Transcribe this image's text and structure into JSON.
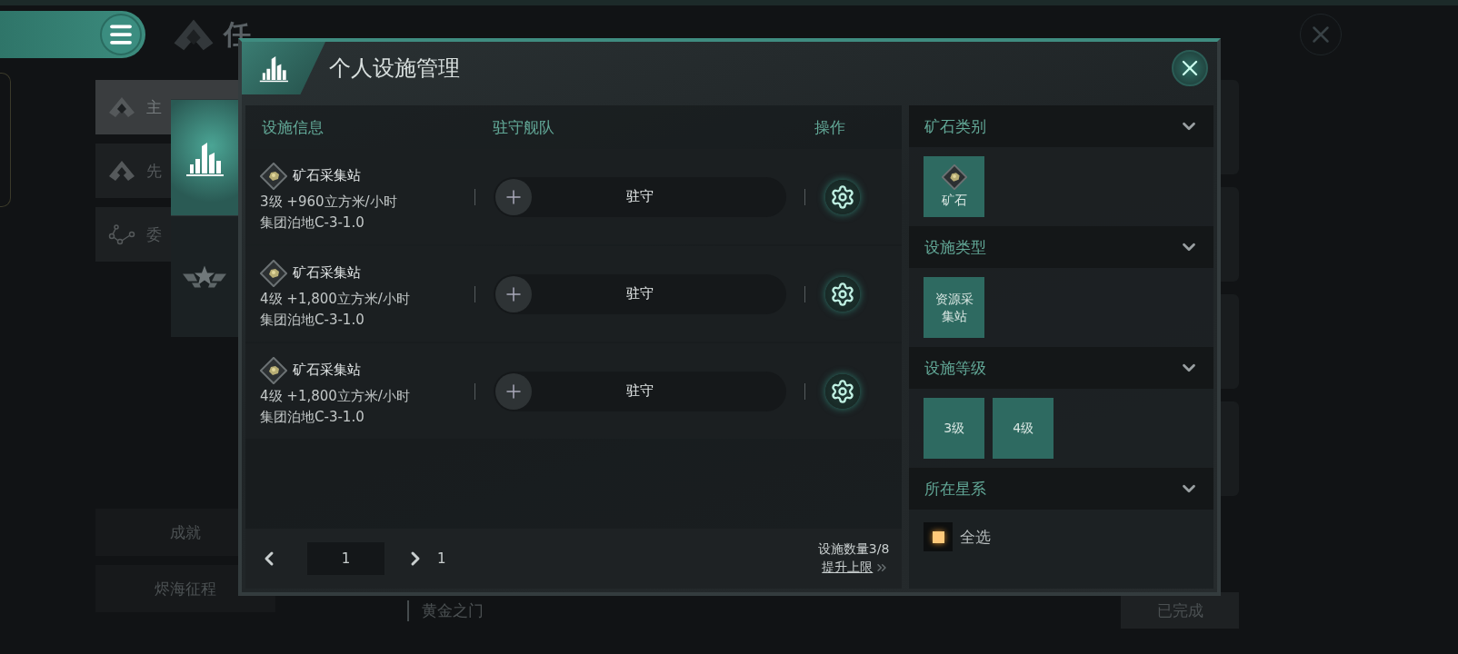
{
  "page": {
    "title": "任"
  },
  "sidebar": {
    "items": [
      {
        "label": "主",
        "kind": "emblem",
        "selected": true
      },
      {
        "label": "先",
        "kind": "emblem",
        "selected": false
      },
      {
        "label": "委",
        "kind": "nodes",
        "selected": false
      }
    ],
    "bottom_buttons": [
      "成就",
      "烬海征程"
    ]
  },
  "background_task": {
    "name": "黄金之门",
    "status": "已完成"
  },
  "dialog": {
    "title": "个人设施管理",
    "side_tabs": [
      {
        "kind": "buildings",
        "selected": true
      },
      {
        "kind": "emblem",
        "selected": false
      }
    ],
    "columns": [
      "设施信息",
      "驻守舰队",
      "操作"
    ],
    "rows": [
      {
        "name": "矿石采集站",
        "output": "3级 +960立方米/小时",
        "location": "集团泊地C-3-1.0",
        "garrison": "驻守"
      },
      {
        "name": "矿石采集站",
        "output": "4级 +1,800立方米/小时",
        "location": "集团泊地C-3-1.0",
        "garrison": "驻守"
      },
      {
        "name": "矿石采集站",
        "output": "4级 +1,800立方米/小时",
        "location": "集团泊地C-3-1.0",
        "garrison": "驻守"
      }
    ],
    "pager": {
      "page": "1",
      "total": "1"
    },
    "count": "设施数量3/8",
    "upgrade_link": "提升上限"
  },
  "filters": [
    {
      "title": "矿石类别",
      "options": [
        {
          "label": "矿石",
          "kind": "ore",
          "selected": true
        }
      ]
    },
    {
      "title": "设施类型",
      "options": [
        {
          "label": "资源采集站",
          "kind": "tile",
          "selected": true
        }
      ]
    },
    {
      "title": "设施等级",
      "options": [
        {
          "label": "3级",
          "kind": "tile",
          "selected": true
        },
        {
          "label": "4级",
          "kind": "tile",
          "selected": true
        }
      ]
    },
    {
      "title": "所在星系",
      "options": [
        {
          "label": "全选",
          "kind": "checkbox",
          "checked": true
        }
      ]
    }
  ]
}
